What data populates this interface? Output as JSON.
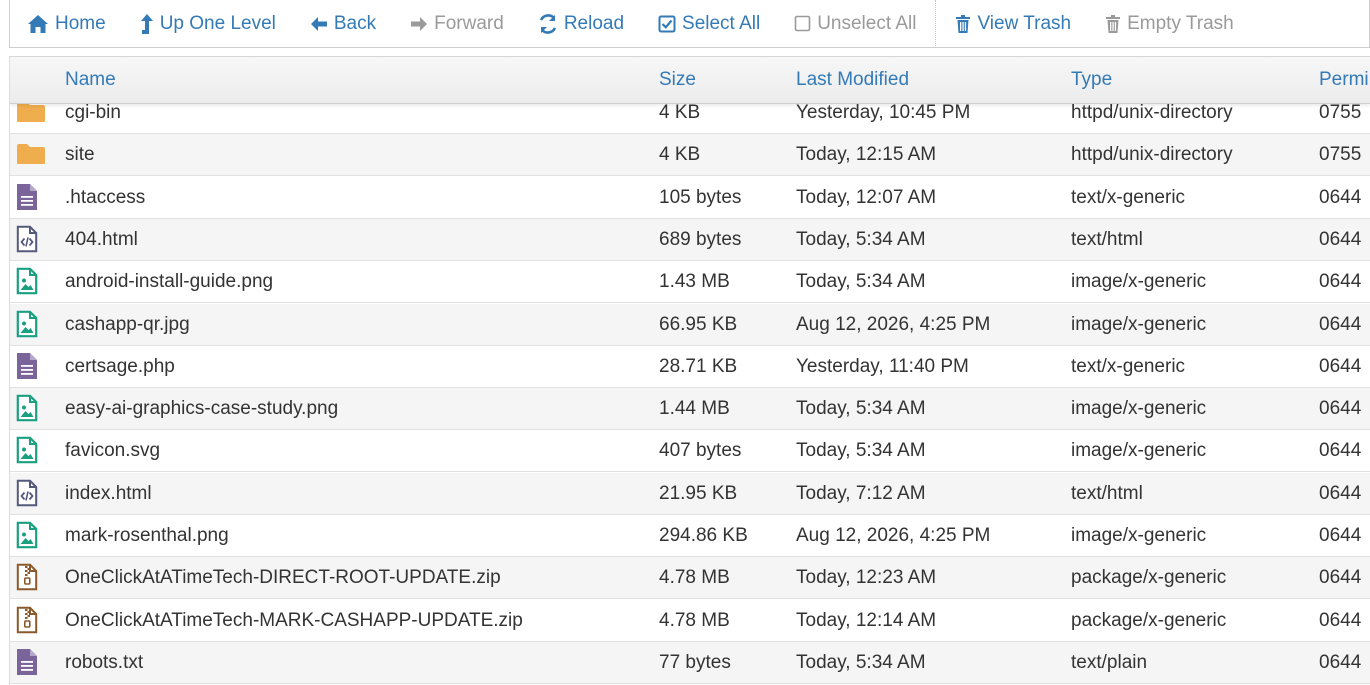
{
  "toolbar": {
    "home": "Home",
    "up": "Up One Level",
    "back": "Back",
    "forward": "Forward",
    "reload": "Reload",
    "select_all": "Select All",
    "unselect_all": "Unselect All",
    "view_trash": "View Trash",
    "empty_trash": "Empty Trash"
  },
  "columns": {
    "name": "Name",
    "size": "Size",
    "modified": "Last Modified",
    "type": "Type",
    "perms": "Permi"
  },
  "colors": {
    "link": "#337ab7",
    "folder": "#f0ad4e",
    "text_file": "#7a6499",
    "image_file": "#1aa080",
    "html_file": "#555a7c",
    "zip_file": "#8b5a2b"
  },
  "files": [
    {
      "icon": "folder-icon",
      "name": "cgi-bin",
      "size": "4 KB",
      "modified": "Yesterday, 10:45 PM",
      "type": "httpd/unix-directory",
      "perms": "0755"
    },
    {
      "icon": "folder-icon",
      "name": "site",
      "size": "4 KB",
      "modified": "Today, 12:15 AM",
      "type": "httpd/unix-directory",
      "perms": "0755"
    },
    {
      "icon": "text-file-icon",
      "name": ".htaccess",
      "size": "105 bytes",
      "modified": "Today, 12:07 AM",
      "type": "text/x-generic",
      "perms": "0644"
    },
    {
      "icon": "html-file-icon",
      "name": "404.html",
      "size": "689 bytes",
      "modified": "Today, 5:34 AM",
      "type": "text/html",
      "perms": "0644"
    },
    {
      "icon": "image-file-icon",
      "name": "android-install-guide.png",
      "size": "1.43 MB",
      "modified": "Today, 5:34 AM",
      "type": "image/x-generic",
      "perms": "0644"
    },
    {
      "icon": "image-file-icon",
      "name": "cashapp-qr.jpg",
      "size": "66.95 KB",
      "modified": "Aug 12, 2026, 4:25 PM",
      "type": "image/x-generic",
      "perms": "0644"
    },
    {
      "icon": "text-file-icon",
      "name": "certsage.php",
      "size": "28.71 KB",
      "modified": "Yesterday, 11:40 PM",
      "type": "text/x-generic",
      "perms": "0644"
    },
    {
      "icon": "image-file-icon",
      "name": "easy-ai-graphics-case-study.png",
      "size": "1.44 MB",
      "modified": "Today, 5:34 AM",
      "type": "image/x-generic",
      "perms": "0644"
    },
    {
      "icon": "image-file-icon",
      "name": "favicon.svg",
      "size": "407 bytes",
      "modified": "Today, 5:34 AM",
      "type": "image/x-generic",
      "perms": "0644"
    },
    {
      "icon": "html-file-icon",
      "name": "index.html",
      "size": "21.95 KB",
      "modified": "Today, 7:12 AM",
      "type": "text/html",
      "perms": "0644"
    },
    {
      "icon": "image-file-icon",
      "name": "mark-rosenthal.png",
      "size": "294.86 KB",
      "modified": "Aug 12, 2026, 4:25 PM",
      "type": "image/x-generic",
      "perms": "0644"
    },
    {
      "icon": "zip-file-icon",
      "name": "OneClickAtATimeTech-DIRECT-ROOT-UPDATE.zip",
      "size": "4.78 MB",
      "modified": "Today, 12:23 AM",
      "type": "package/x-generic",
      "perms": "0644"
    },
    {
      "icon": "zip-file-icon",
      "name": "OneClickAtATimeTech-MARK-CASHAPP-UPDATE.zip",
      "size": "4.78 MB",
      "modified": "Today, 12:14 AM",
      "type": "package/x-generic",
      "perms": "0644"
    },
    {
      "icon": "text-file-icon",
      "name": "robots.txt",
      "size": "77 bytes",
      "modified": "Today, 5:34 AM",
      "type": "text/plain",
      "perms": "0644"
    }
  ]
}
